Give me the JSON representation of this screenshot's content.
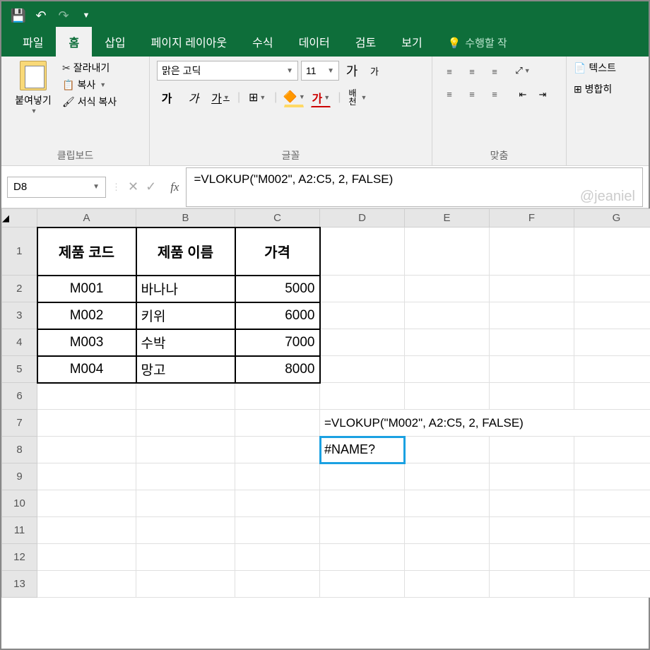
{
  "titlebar": {
    "save": "💾",
    "undo": "↶",
    "redo": "↷"
  },
  "tabs": {
    "file": "파일",
    "home": "홈",
    "insert": "삽입",
    "layout": "페이지 레이아웃",
    "formula": "수식",
    "data": "데이터",
    "review": "검토",
    "view": "보기",
    "tell": "수행할 작"
  },
  "ribbon": {
    "clipboard": {
      "paste": "붙여넣기",
      "cut": "잘라내기",
      "copy": "복사",
      "format": "서식 복사",
      "label": "클립보드"
    },
    "font": {
      "name": "맑은 고딕",
      "size": "11",
      "grow": "가",
      "shrink": "가",
      "bold": "가",
      "italic": "가",
      "underline": "가",
      "font_color": "가",
      "hanja": "배천",
      "label": "글꼴"
    },
    "align": {
      "wrap": "텍스트",
      "merge": "병합히",
      "label": "맞춤"
    }
  },
  "namebox": "D8",
  "formula_bar": "=VLOKUP(\"M002\", A2:C5, 2, FALSE)",
  "watermark": "@jeaniel",
  "columns": [
    "A",
    "B",
    "C",
    "D",
    "E",
    "F",
    "G"
  ],
  "rows": [
    "1",
    "2",
    "3",
    "4",
    "5",
    "6",
    "7",
    "8",
    "9",
    "10",
    "11",
    "12",
    "13"
  ],
  "table": {
    "headers": [
      "제품 코드",
      "제품 이름",
      "가격"
    ],
    "data": [
      [
        "M001",
        "바나나",
        "5000"
      ],
      [
        "M002",
        "키위",
        "6000"
      ],
      [
        "M003",
        "수박",
        "7000"
      ],
      [
        "M004",
        "망고",
        "8000"
      ]
    ]
  },
  "cell_d7": "=VLOKUP(\"M002\", A2:C5, 2, FALSE)",
  "cell_d8": "#NAME?"
}
